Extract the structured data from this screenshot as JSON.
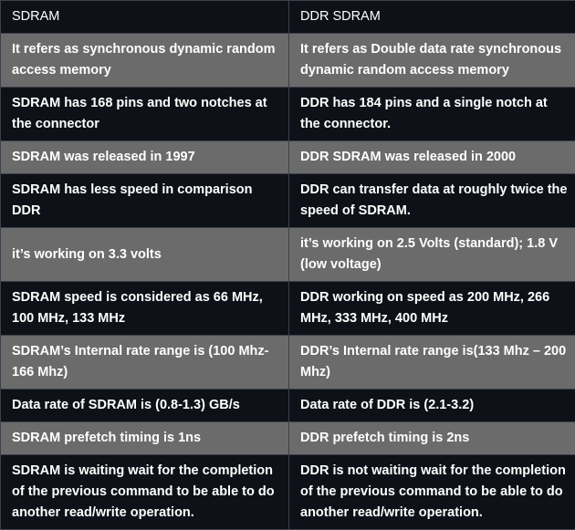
{
  "table": {
    "headers": [
      "SDRAM",
      "DDR SDRAM"
    ],
    "rows": [
      [
        "It refers as synchronous dynamic random access memory",
        "It refers as Double data rate synchronous dynamic random access memory"
      ],
      [
        "SDRAM has 168 pins and two notches at the connector",
        "DDR has 184 pins and a single notch at the connector."
      ],
      [
        "SDRAM was released in 1997",
        "DDR SDRAM was released in 2000"
      ],
      [
        "SDRAM has less speed in comparison DDR",
        "DDR can transfer data at roughly twice the speed of SDRAM."
      ],
      [
        "it’s working on 3.3 volts",
        "it’s working on 2.5 Volts (standard); 1.8 V (low voltage)"
      ],
      [
        "SDRAM speed is considered as 66 MHz, 100 MHz, 133 MHz",
        "DDR working on speed as 200 MHz, 266 MHz, 333 MHz, 400 MHz"
      ],
      [
        "SDRAM’s Internal rate range is (100 Mhz-166 Mhz)",
        "DDR’s Internal rate range is(133 Mhz – 200 Mhz)"
      ],
      [
        "Data rate of SDRAM is (0.8-1.3) GB/s",
        "Data rate of DDR is (2.1-3.2)"
      ],
      [
        "SDRAM prefetch timing is 1ns",
        "DDR prefetch timing is 2ns"
      ],
      [
        "SDRAM is waiting wait for the completion of the previous command to be able to do another read/write operation.",
        "DDR is not waiting wait for the completion of the previous command to be able to do another read/write operation."
      ]
    ]
  },
  "colors": {
    "dark_row": "#0e1117",
    "light_row": "#6b6b6b",
    "text": "#ffffff",
    "border": "#3c4048"
  }
}
